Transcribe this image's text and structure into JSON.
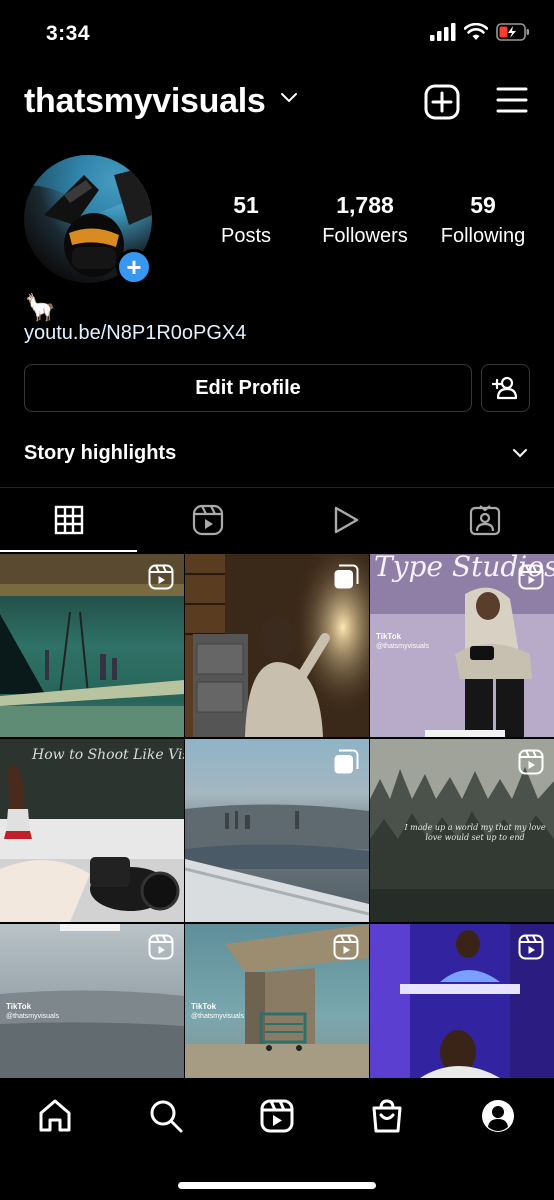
{
  "status_bar": {
    "time": "3:34"
  },
  "header": {
    "username": "thatsmyvisuals",
    "icons": [
      "chevron-down-icon",
      "new-post-icon",
      "menu-icon"
    ]
  },
  "profile": {
    "stats": [
      {
        "value": "51",
        "label": "Posts"
      },
      {
        "value": "1,788",
        "label": "Followers"
      },
      {
        "value": "59",
        "label": "Following"
      }
    ],
    "bio_emoji": "🦙",
    "bio_link": "youtu.be/N8P1R0oPGX4"
  },
  "buttons": {
    "edit_profile": "Edit Profile"
  },
  "highlights": {
    "label": "Story highlights"
  },
  "tabs": [
    "grid-icon",
    "reels-icon",
    "videos-icon",
    "tagged-icon"
  ],
  "grid": {
    "tiktok_label": "TikTok",
    "tiktok_handle": "@thatsmyvisuals",
    "post_texts": {
      "studio_sign": "Type Studios",
      "chalkboard": "How to Shoot Like Visuals",
      "forest_quote": "I made up a world my that my love love would set up to end"
    }
  },
  "bottom_nav": [
    "home-icon",
    "search-icon",
    "reels-icon",
    "shop-icon",
    "profile-icon"
  ],
  "colors": {
    "background": "#000000",
    "accent": "#3897f0",
    "border": "#363636"
  }
}
